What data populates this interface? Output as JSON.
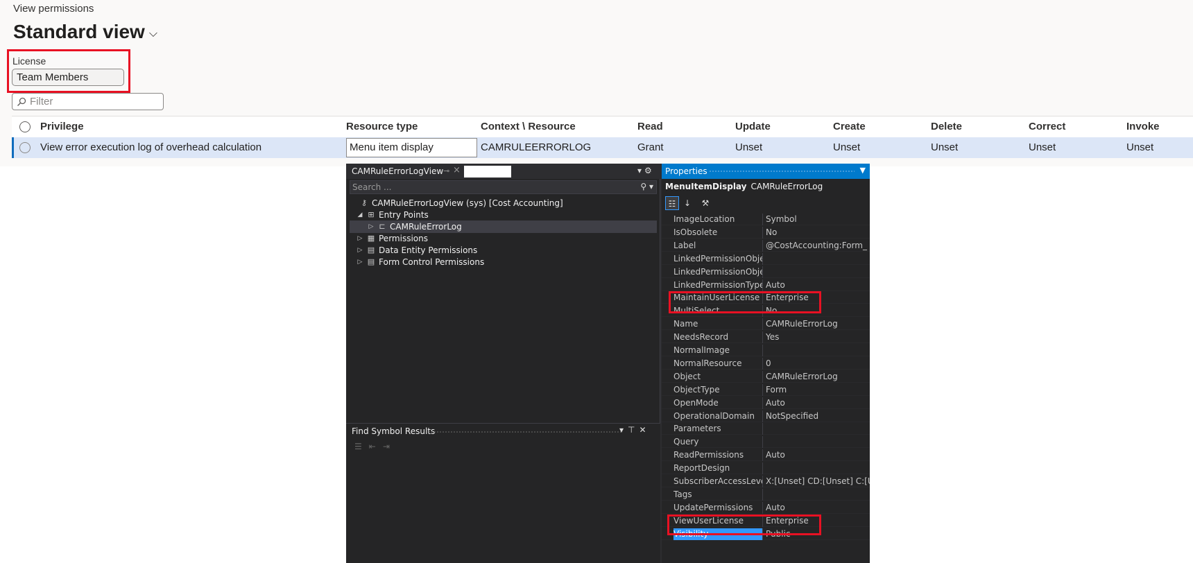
{
  "breadcrumb": "View permissions",
  "page_title": "Standard view",
  "license": {
    "label": "License",
    "value": "Team Members"
  },
  "filter": {
    "placeholder": "Filter"
  },
  "grid": {
    "columns": [
      "Privilege",
      "Resource type",
      "Context \\ Resource",
      "Read",
      "Update",
      "Create",
      "Delete",
      "Correct",
      "Invoke"
    ],
    "row": {
      "privilege": "View error execution log of overhead calculation",
      "resource_type": "Menu item display",
      "context": "CAMRULEERRORLOG",
      "read": "Grant",
      "update": "Unset",
      "create": "Unset",
      "delete": "Unset",
      "correct": "Unset",
      "invoke": "Unset"
    }
  },
  "explorer": {
    "tab_title": "CAMRuleErrorLogView",
    "search_placeholder": "Search ...",
    "tree": [
      {
        "label": "CAMRuleErrorLogView (sys) [Cost Accounting]",
        "icon": "key-icon"
      },
      {
        "label": "Entry Points",
        "icon": "entry-points-icon"
      },
      {
        "label": "CAMRuleErrorLog",
        "icon": "menu-item-icon"
      },
      {
        "label": "Permissions",
        "icon": "permissions-icon"
      },
      {
        "label": "Data Entity Permissions",
        "icon": "table-icon"
      },
      {
        "label": "Form Control Permissions",
        "icon": "table-icon"
      }
    ]
  },
  "find_results": {
    "title": "Find Symbol Results"
  },
  "properties": {
    "title": "Properties",
    "object_type": "MenuItemDisplay",
    "object_name": "CAMRuleErrorLog",
    "rows": [
      {
        "name": "ImageLocation",
        "value": "Symbol"
      },
      {
        "name": "IsObsolete",
        "value": "No"
      },
      {
        "name": "Label",
        "value": "@CostAccounting:Form_"
      },
      {
        "name": "LinkedPermissionObject",
        "value": ""
      },
      {
        "name": "LinkedPermissionObjectCh",
        "value": ""
      },
      {
        "name": "LinkedPermissionType",
        "value": "Auto"
      },
      {
        "name": "MaintainUserLicense",
        "value": "Enterprise"
      },
      {
        "name": "MultiSelect",
        "value": "No"
      },
      {
        "name": "Name",
        "value": "CAMRuleErrorLog"
      },
      {
        "name": "NeedsRecord",
        "value": "Yes"
      },
      {
        "name": "NormalImage",
        "value": ""
      },
      {
        "name": "NormalResource",
        "value": "0"
      },
      {
        "name": "Object",
        "value": "CAMRuleErrorLog"
      },
      {
        "name": "ObjectType",
        "value": "Form"
      },
      {
        "name": "OpenMode",
        "value": "Auto"
      },
      {
        "name": "OperationalDomain",
        "value": "NotSpecified"
      },
      {
        "name": "Parameters",
        "value": ""
      },
      {
        "name": "Query",
        "value": ""
      },
      {
        "name": "ReadPermissions",
        "value": "Auto"
      },
      {
        "name": "ReportDesign",
        "value": ""
      },
      {
        "name": "SubscriberAccessLevel",
        "value": "X:[Unset] CD:[Unset] C:[U"
      },
      {
        "name": "Tags",
        "value": ""
      },
      {
        "name": "UpdatePermissions",
        "value": "Auto"
      },
      {
        "name": "ViewUserLicense",
        "value": "Enterprise"
      },
      {
        "name": "Visibility",
        "value": "Public"
      }
    ]
  },
  "colors": {
    "highlight": "#e81123",
    "selection": "#dce6f7",
    "vs_accent": "#007acc"
  }
}
